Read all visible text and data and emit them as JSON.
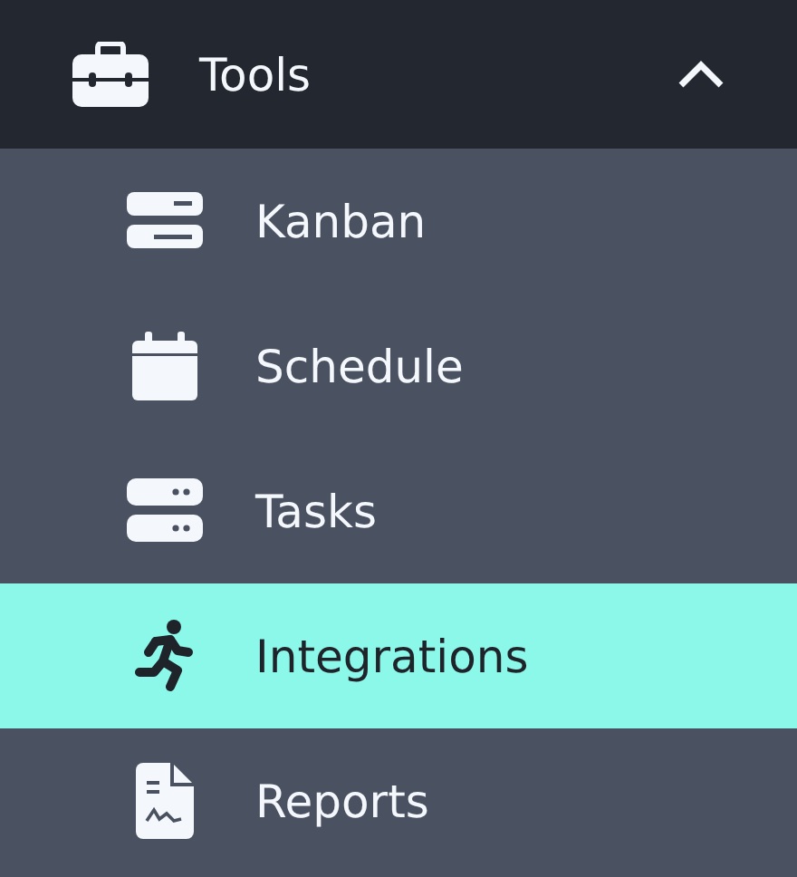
{
  "menu": {
    "title": "Tools",
    "expanded": true
  },
  "items": [
    {
      "label": "Kanban",
      "selected": false
    },
    {
      "label": "Schedule",
      "selected": false
    },
    {
      "label": "Tasks",
      "selected": false
    },
    {
      "label": "Integrations",
      "selected": true
    },
    {
      "label": "Reports",
      "selected": false
    }
  ]
}
